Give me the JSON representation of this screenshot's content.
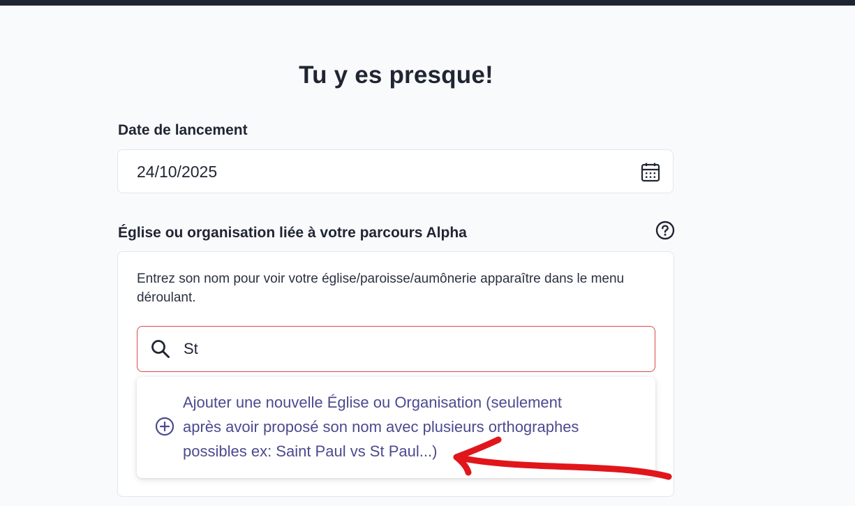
{
  "page": {
    "title": "Tu y es presque!"
  },
  "date_field": {
    "label": "Date de lancement",
    "value": "24/10/2025",
    "icon": "calendar-icon"
  },
  "org_field": {
    "label": "Église ou organisation liée à votre parcours Alpha",
    "help_icon": "help-icon",
    "helper_text": "Entrez son nom pour voir votre église/paroisse/aumônerie apparaître dans le menu déroulant.",
    "search": {
      "value": "St",
      "icon": "search-icon"
    },
    "dropdown": {
      "add_option": {
        "icon": "plus-circle-icon",
        "line1": "Ajouter une nouvelle Église ou Organisation (seulement",
        "line2": "après avoir proposé son nom avec plusieurs orthographes",
        "line3": "possibles ex: Saint Paul vs St Paul...)"
      }
    }
  },
  "colors": {
    "topbar": "#1e2432",
    "background": "#f9fafb",
    "text": "#1f2533",
    "accent": "#4b4a8f",
    "error_border": "#d94a4a",
    "annotation": "#e0161b"
  }
}
